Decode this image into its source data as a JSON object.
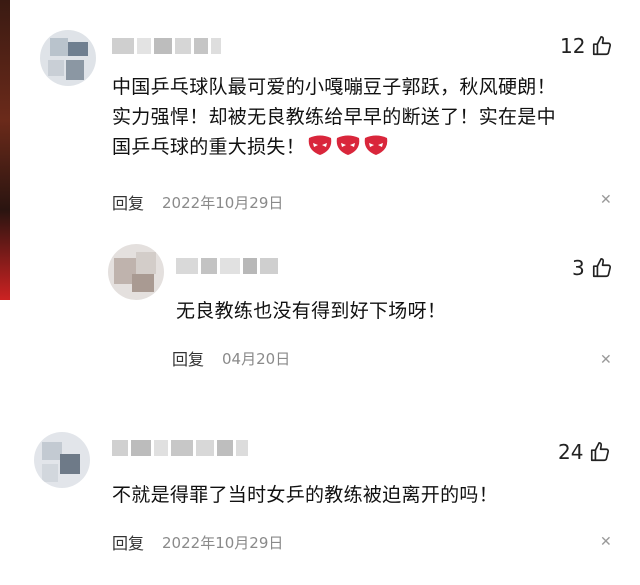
{
  "comments": [
    {
      "likes": "12",
      "text_lines": [
        "中国乒乓球队最可爱的小嘎嘣豆子郭跃，秋风硬朗！",
        "实力强悍！却被无良教练给早早的断送了！实在是中",
        "国乒乓球的重大损失！"
      ],
      "reply_label": "回复",
      "date": "2022年10月29日",
      "close_glyph": "✕",
      "emoji_icons": [
        "angry-face-icon",
        "angry-face-icon",
        "angry-face-icon"
      ]
    },
    {
      "likes": "3",
      "text": "无良教练也没有得到好下场呀！",
      "reply_label": "回复",
      "date": "04月20日",
      "close_glyph": "✕"
    },
    {
      "likes": "24",
      "text": "不就是得罪了当时女乒的教练被迫离开的吗！",
      "reply_label": "回复",
      "date": "2022年10月29日",
      "close_glyph": "✕"
    }
  ],
  "colors": {
    "like_icon": "#222222",
    "emoji": "#d9263b",
    "meta_text": "#8a8a8a"
  },
  "icons": {
    "like": "thumbs-up-icon",
    "close": "close-icon"
  }
}
